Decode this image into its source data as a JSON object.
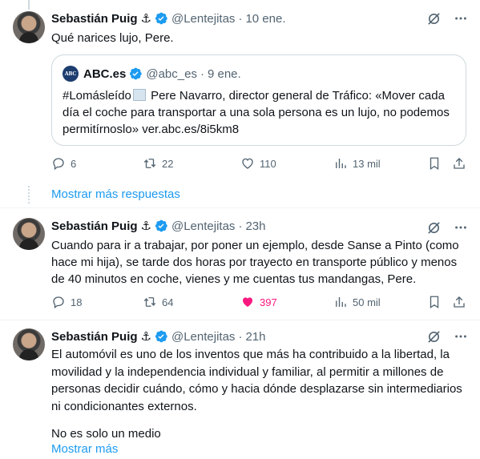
{
  "tweets": [
    {
      "name": "Sebastián Puig",
      "anchor": "⚓",
      "handle": "@Lentejitas",
      "sep": "·",
      "time": "10 ene.",
      "text": "Qué narices lujo, Pere.",
      "quote": {
        "logo": "ABC",
        "name": "ABC.es",
        "handle": "@abc_es",
        "sep": "·",
        "time": "9 ene.",
        "text_before_icon": "#Lomásleído",
        "text_after_icon": " Pere Navarro, director general de Tráfico: «Mover cada día el coche para transportar a una sola persona es un lujo, no podemos permitírnoslo» ver.abc.es/8i5km8"
      },
      "replies": "6",
      "retweets": "22",
      "likes": "110",
      "views": "13 mil"
    },
    {
      "name": "Sebastián Puig",
      "anchor": "⚓",
      "handle": "@Lentejitas",
      "sep": "·",
      "time": "23h",
      "text": "Cuando para ir a trabajar, por poner un ejemplo, desde Sanse a Pinto (como hace mi hija), se tarde dos horas por trayecto en transporte público y menos de 40 minutos en coche, vienes y me cuentas tus mandangas, Pere.",
      "replies": "18",
      "retweets": "64",
      "likes": "397",
      "views": "50 mil"
    },
    {
      "name": "Sebastián Puig",
      "anchor": "⚓",
      "handle": "@Lentejitas",
      "sep": "·",
      "time": "21h",
      "text": "El automóvil es uno de los inventos que más ha contribuido a la libertad, la movilidad y la independencia individual y familiar, al permitir a millones de personas decidir cuándo, cómo y hacia dónde desplazarse sin intermediarios ni condicionantes externos.",
      "text2": "No es solo un medio"
    }
  ],
  "show_more_replies": "Mostrar más respuestas",
  "show_more": "Mostrar más",
  "colors": {
    "accent": "#1d9bf0",
    "like": "#f91880",
    "muted": "#536471"
  }
}
